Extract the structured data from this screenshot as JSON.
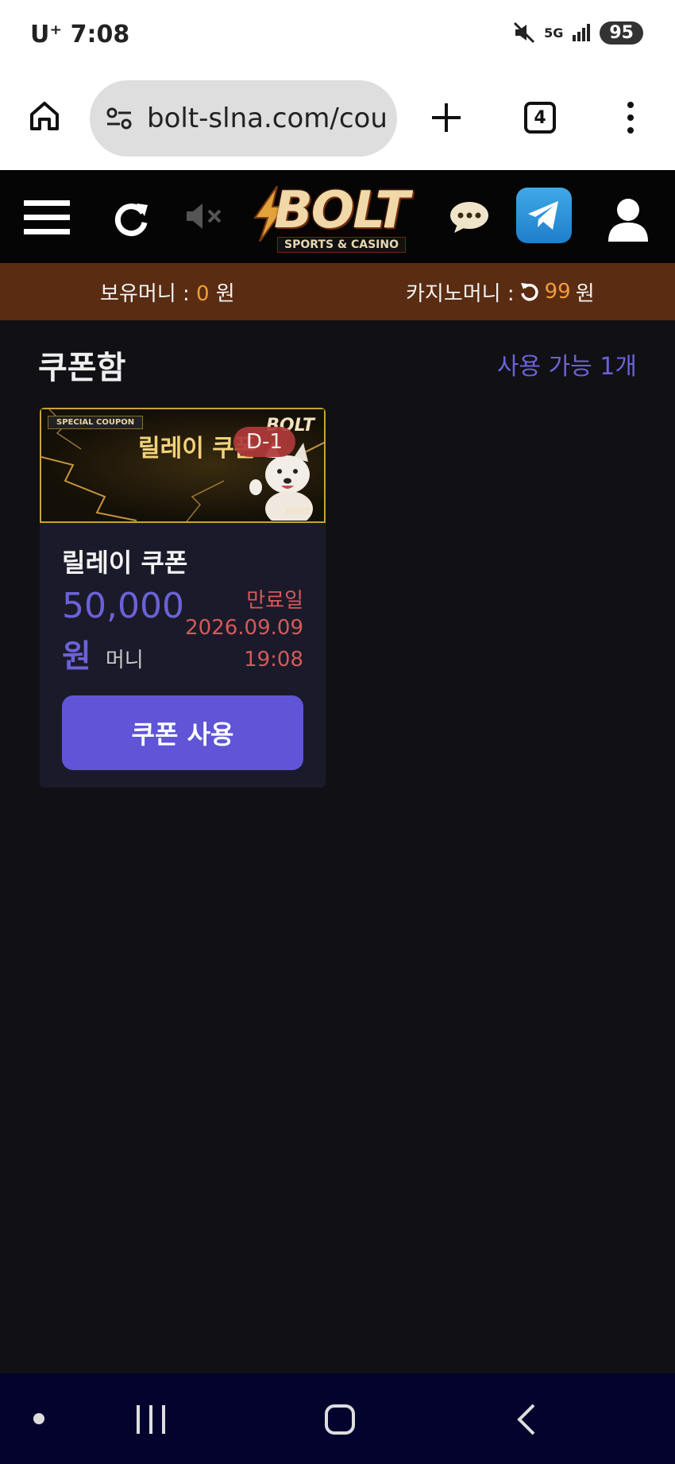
{
  "status_bar": {
    "carrier": "U⁺ 7:08",
    "network": "5G",
    "battery": "95"
  },
  "browser": {
    "url": "bolt-slna.com/cou",
    "tab_count": "4"
  },
  "site": {
    "logo_text": "BOLT",
    "logo_subtext": "SPORTS & CASINO"
  },
  "money_bar": {
    "held_label": "보유머니 : ",
    "held_value": "0",
    "held_unit": " 원",
    "casino_label": "카지노머니 : ",
    "casino_value": "99",
    "casino_unit": " 원"
  },
  "coupon_box": {
    "title": "쿠폰함",
    "available": "사용 가능 1개",
    "coupons": [
      {
        "banner_tag": "SPECIAL COUPON",
        "banner_title": "릴레이 쿠폰",
        "banner_brand": "BOLT",
        "dday": "D-1",
        "name": "릴레이 쿠폰",
        "amount": "50,000",
        "won": "원",
        "unit": "머니",
        "expiry_label": "만료일",
        "expiry_date": "2026.09.09",
        "expiry_time": "19:08",
        "use_button": "쿠폰 사용"
      }
    ]
  },
  "colors": {
    "accent": "#5f55d6",
    "money_bar": "#5a2c12",
    "expiry": "#d35a5a",
    "highlight": "#f39c3c"
  }
}
